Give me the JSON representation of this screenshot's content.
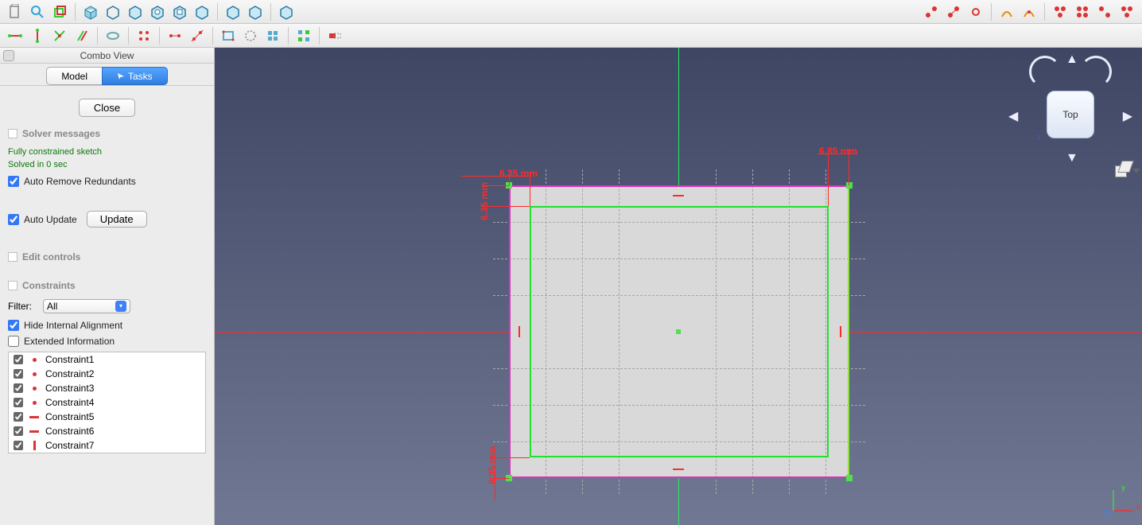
{
  "panel": {
    "title": "Combo View",
    "tab_model": "Model",
    "tab_tasks": "Tasks",
    "close": "Close",
    "sec_solver": "Solver messages",
    "msg1": "Fully constrained sketch",
    "msg2": "Solved in 0 sec",
    "auto_remove": "Auto Remove Redundants",
    "auto_update": "Auto Update",
    "update_btn": "Update",
    "sec_edit": "Edit controls",
    "sec_constraints": "Constraints",
    "filter_label": "Filter:",
    "filter_value": "All",
    "hide_internal": "Hide Internal Alignment",
    "extended_info": "Extended Information",
    "constraints": [
      {
        "name": "Constraint1",
        "icon": "dot"
      },
      {
        "name": "Constraint2",
        "icon": "dot"
      },
      {
        "name": "Constraint3",
        "icon": "dot"
      },
      {
        "name": "Constraint4",
        "icon": "dot"
      },
      {
        "name": "Constraint5",
        "icon": "dash"
      },
      {
        "name": "Constraint6",
        "icon": "dash"
      },
      {
        "name": "Constraint7",
        "icon": "bar"
      }
    ]
  },
  "view": {
    "dim1": "6,35 mm",
    "dim2": "6,35 mm",
    "dim3": "6,35 mm",
    "dim4": "6,35 mm",
    "cube_face": "Top",
    "axis_x": "x",
    "axis_y": "y",
    "axis_z": "z"
  }
}
